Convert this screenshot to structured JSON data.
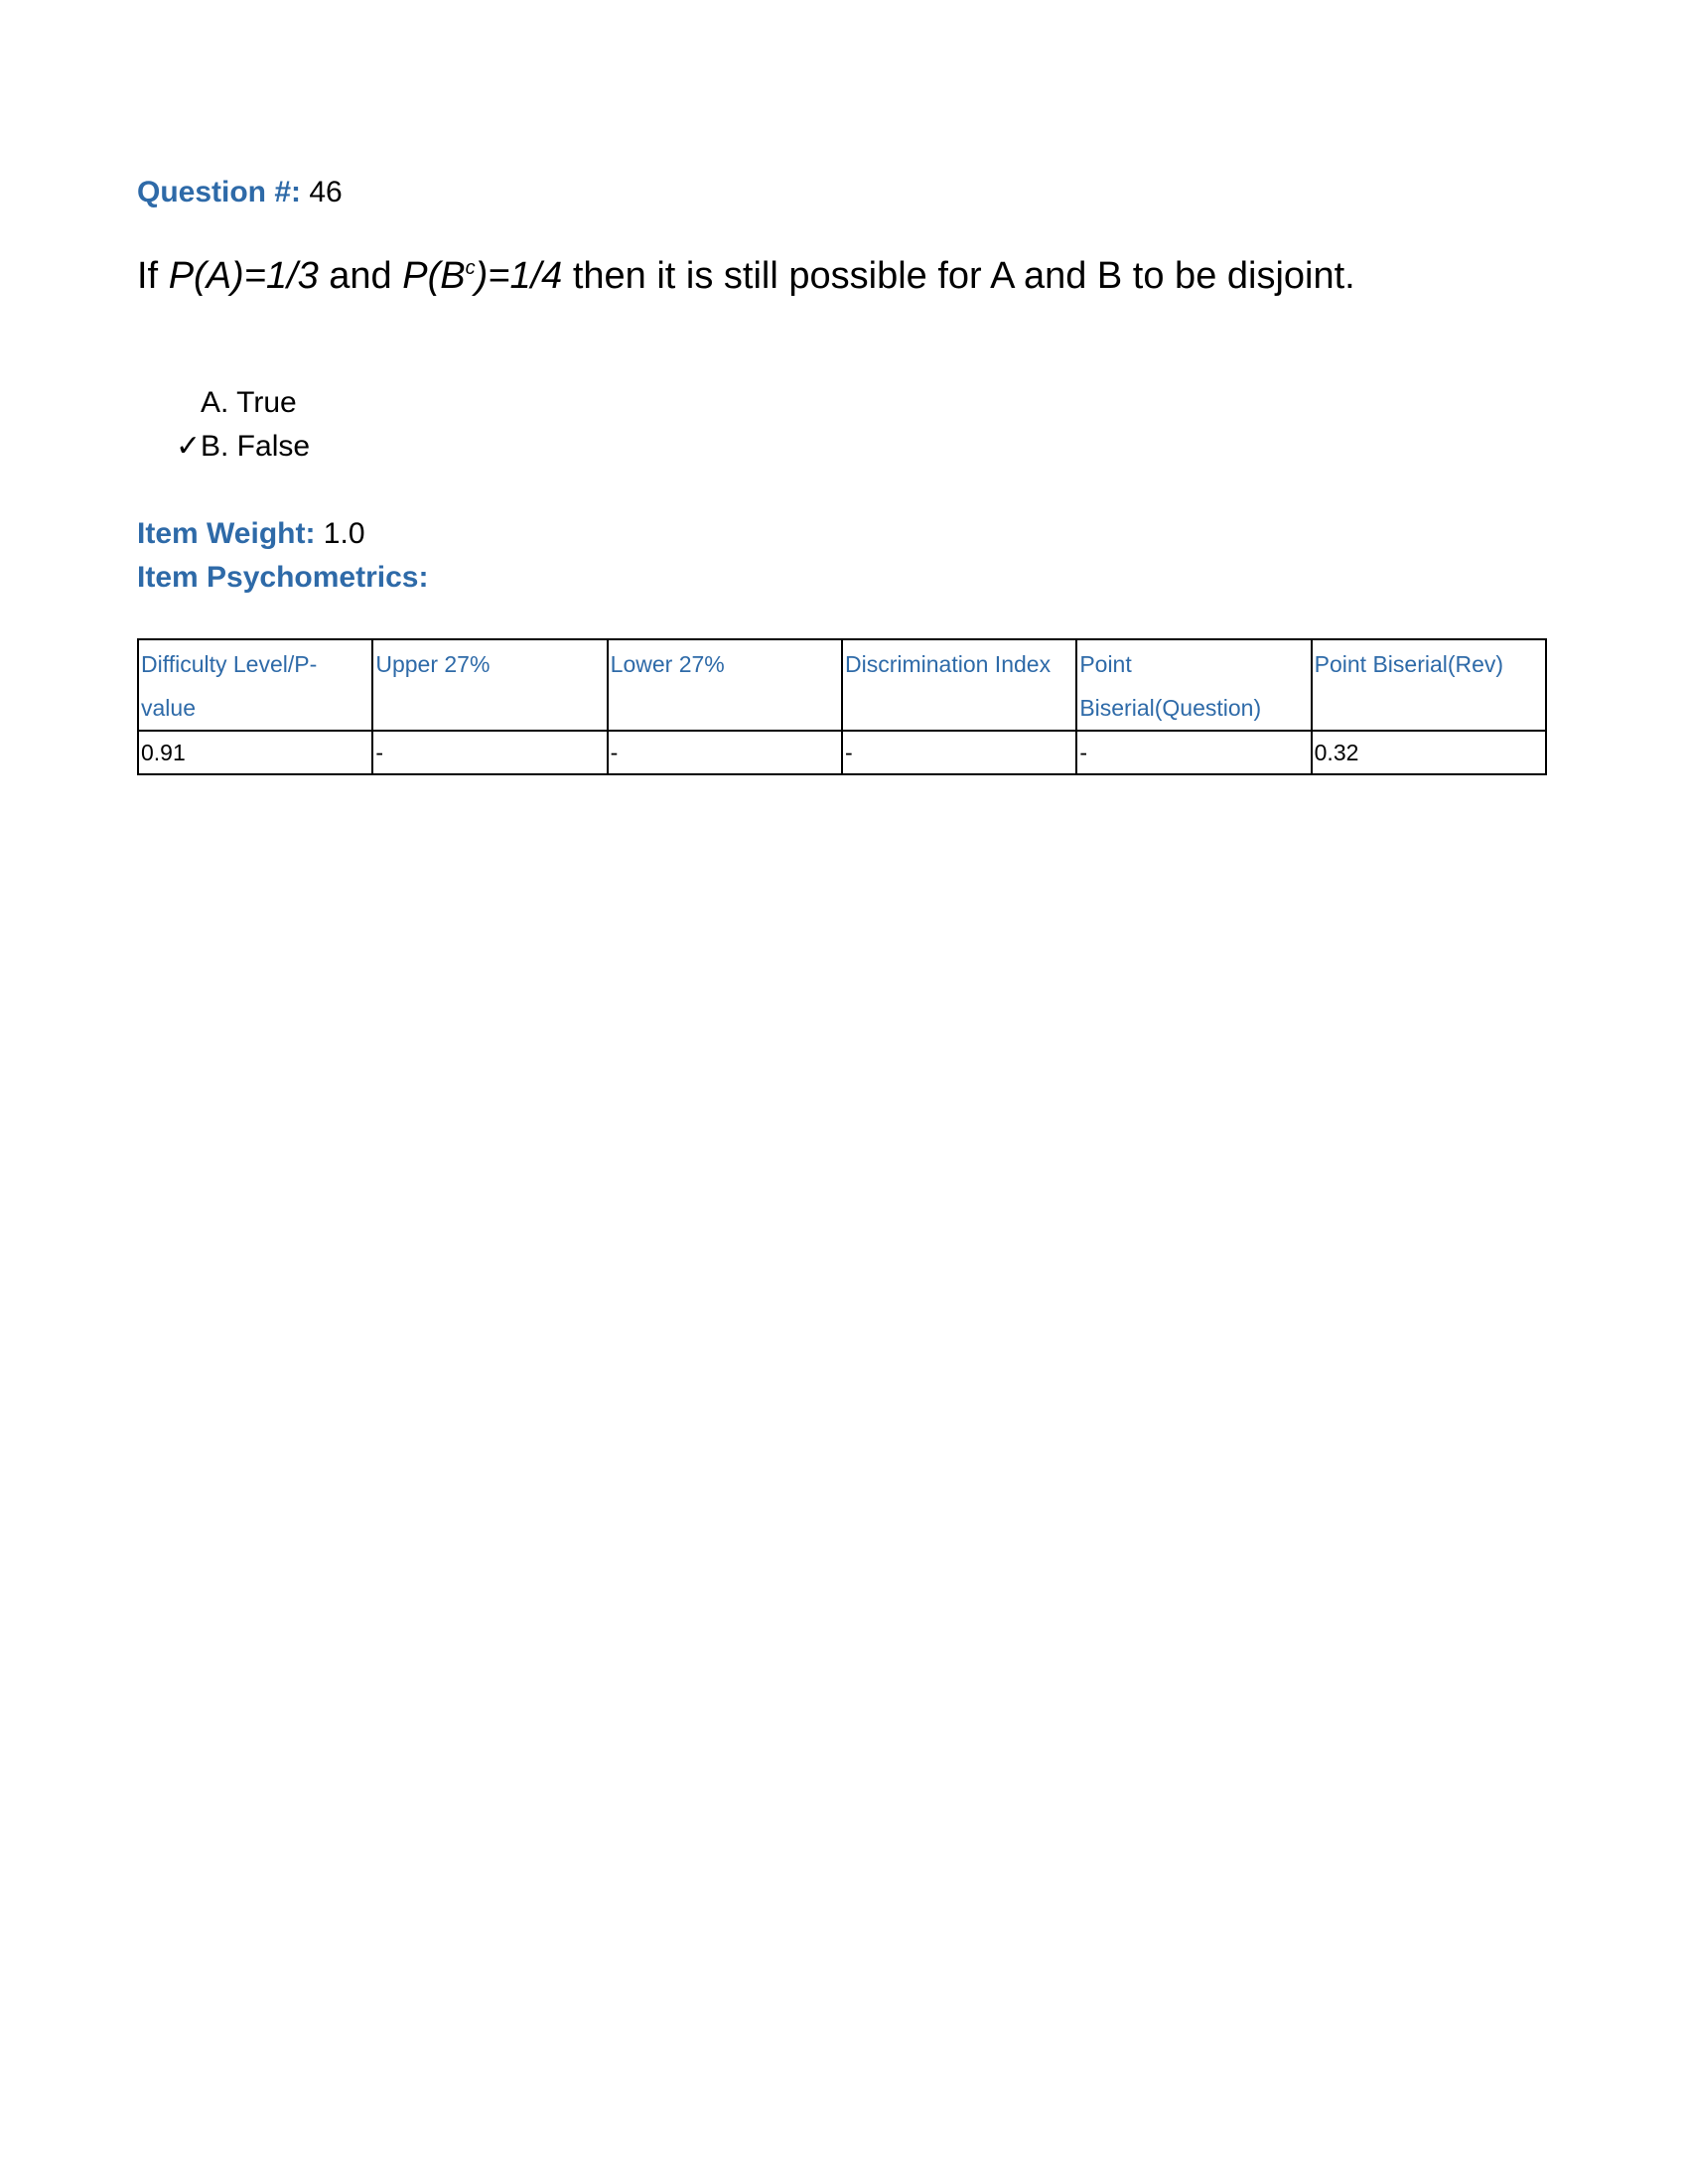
{
  "question": {
    "number_label": "Question #:",
    "number": "46",
    "stem": {
      "part1": "If ",
      "expr1": "P(A)=1/3",
      "part2": " and ",
      "expr2_pre": "P(B",
      "expr2_sup": "c",
      "expr2_post": ")=1/4",
      "part3": " then it is still possible for A and B to be disjoint."
    },
    "options": [
      {
        "check": "",
        "label": "A. True"
      },
      {
        "check": "✓",
        "label": "B. False"
      }
    ]
  },
  "item": {
    "weight_label": "Item Weight:",
    "weight": "1.0",
    "psychometrics_label": "Item Psychometrics:"
  },
  "table": {
    "headers": [
      "Difficulty Level/P-value",
      "Upper 27%",
      "Lower 27%",
      "Discrimination Index",
      "Point Biserial(Question)",
      "Point Biserial(Rev)"
    ],
    "values": [
      "0.91",
      "-",
      "-",
      "-",
      "-",
      "0.32"
    ]
  },
  "colors": {
    "label_blue": "#2e6aa8",
    "text": "#000000"
  }
}
